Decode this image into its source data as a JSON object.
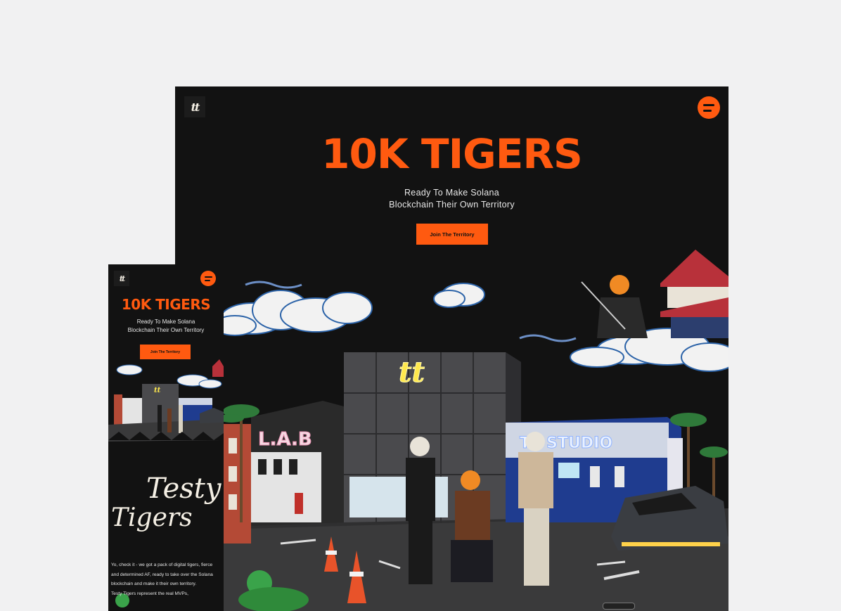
{
  "desktop": {
    "logo_mark": "tt",
    "title": "10K TIGERS",
    "tagline_line1": "Ready To Make Solana",
    "tagline_line2": "Blockchain Their Own Territory",
    "cta_label": "Join The Territory",
    "signs": {
      "lab": "L.A.B",
      "studio": "TT STUDIO"
    }
  },
  "mobile": {
    "logo_mark": "tt",
    "title": "10K TIGERS",
    "tagline_line1": "Ready To Make Solana",
    "tagline_line2": "Blockchain Their Own Territory",
    "cta_label": "Join The Territory",
    "section_heading": "Testy Tigers",
    "section_heading_line1": "Testy",
    "section_heading_line2": "Tigers",
    "paragraph1": "Yo, check it - we got a pack of digital tigers, fierce and determined AF, ready to take over the Solana blockchain and make it their own territory.",
    "paragraph2": "Testy Tigers represent the real MVPs,"
  },
  "colors": {
    "brand_orange": "#ff5a10",
    "background": "#121212",
    "page_background": "#f1f1f2"
  },
  "icons": {
    "menu": "menu-icon",
    "logo": "tt-logo-icon"
  }
}
